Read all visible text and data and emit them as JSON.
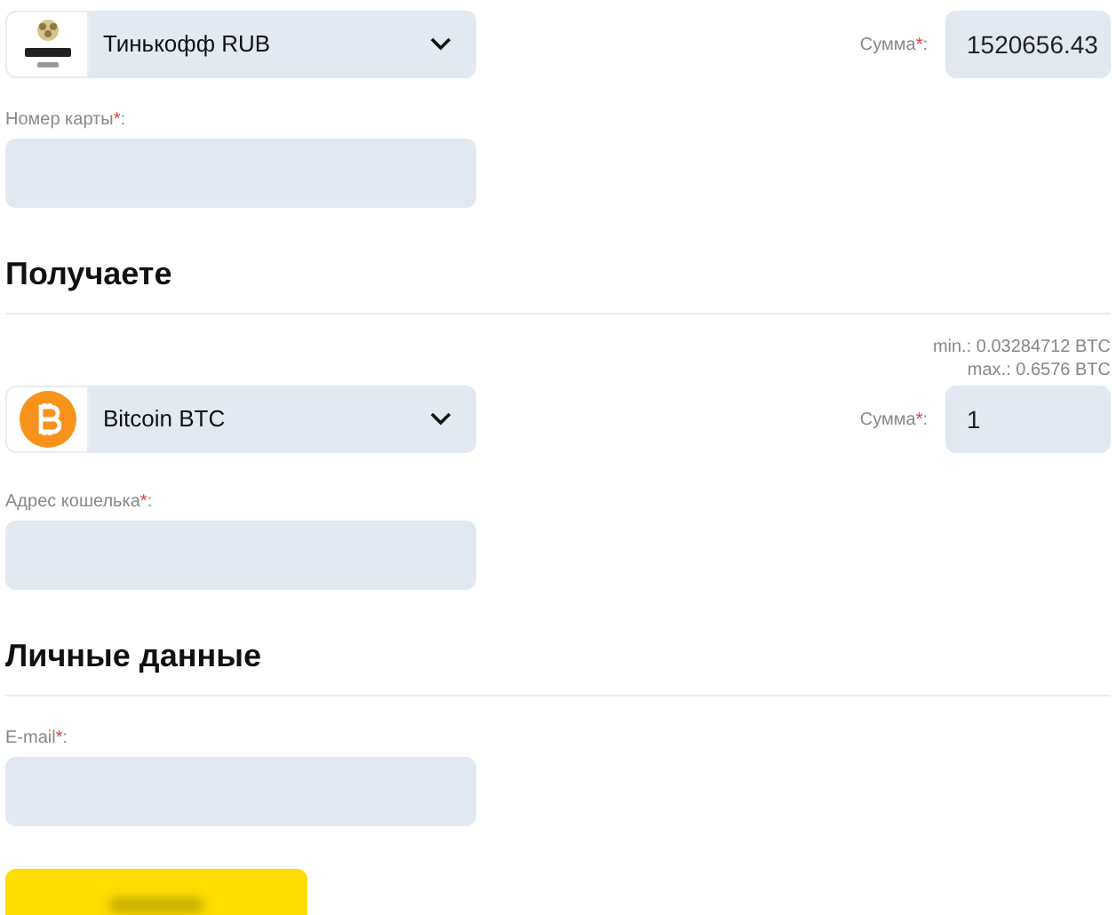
{
  "give": {
    "currency": {
      "label": "Тинькофф RUB",
      "kind": "tinkoff"
    },
    "amount": {
      "label": "Сумма",
      "mark": "*",
      "end": ":",
      "value": "1520656.43"
    },
    "field": {
      "label": "Номер карты",
      "mark": "*",
      "end": ":"
    }
  },
  "receive": {
    "heading": "Получаете",
    "limits": [
      "min.: 0.03284712 BTC",
      "max.: 0.6576 BTC"
    ],
    "currency": {
      "label": "Bitcoin BTC",
      "kind": "bitcoin"
    },
    "amount": {
      "label": "Сумма",
      "mark": "*",
      "end": ":",
      "value": "1"
    },
    "field": {
      "label": "Адрес кошелька",
      "mark": "*",
      "end": ":"
    }
  },
  "personal": {
    "heading": "Личные данные",
    "field": {
      "label": "E-mail",
      "mark": "*",
      "end": ":"
    }
  },
  "submit": {
    "kind": "blurred"
  }
}
